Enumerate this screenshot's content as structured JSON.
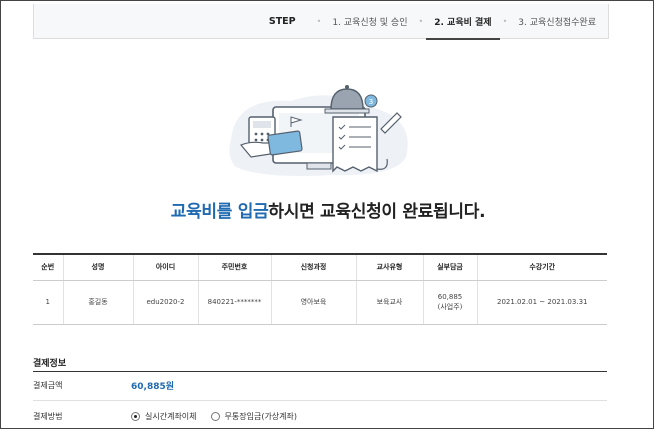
{
  "steps": {
    "title": "STEP",
    "items": [
      {
        "label": "1.  교육신청 및 승인"
      },
      {
        "label": "2.  교육비 결제"
      },
      {
        "label": "3.  교육신청접수완료"
      }
    ]
  },
  "illustration": {
    "badge": "3"
  },
  "headline": {
    "accent": "교육비를 입금",
    "rest": "하시면 교육신청이 완료됩니다."
  },
  "table": {
    "headers": [
      "순번",
      "성명",
      "아이디",
      "주민번호",
      "신청과정",
      "교사유형",
      "실부담금",
      "수강기간"
    ],
    "rows": [
      {
        "no": "1",
        "name": "홍길동",
        "id": "edu2020-2",
        "ssn": "840221-*******",
        "course": "영아보육",
        "teacher_type": "보육교사",
        "cost": "60,885",
        "cost_note": "(사업주)",
        "period": "2021.02.01 ~ 2021.03.31"
      }
    ]
  },
  "payment": {
    "title": "결제정보",
    "amount_label": "결제금액",
    "amount": "60,885원",
    "method_label": "결제방법",
    "methods": [
      "실시간계좌이체",
      "무통장입금(가상계좌)"
    ],
    "selected_method": "실시간계좌이체"
  },
  "colors": {
    "accent": "#1f6ab0"
  }
}
